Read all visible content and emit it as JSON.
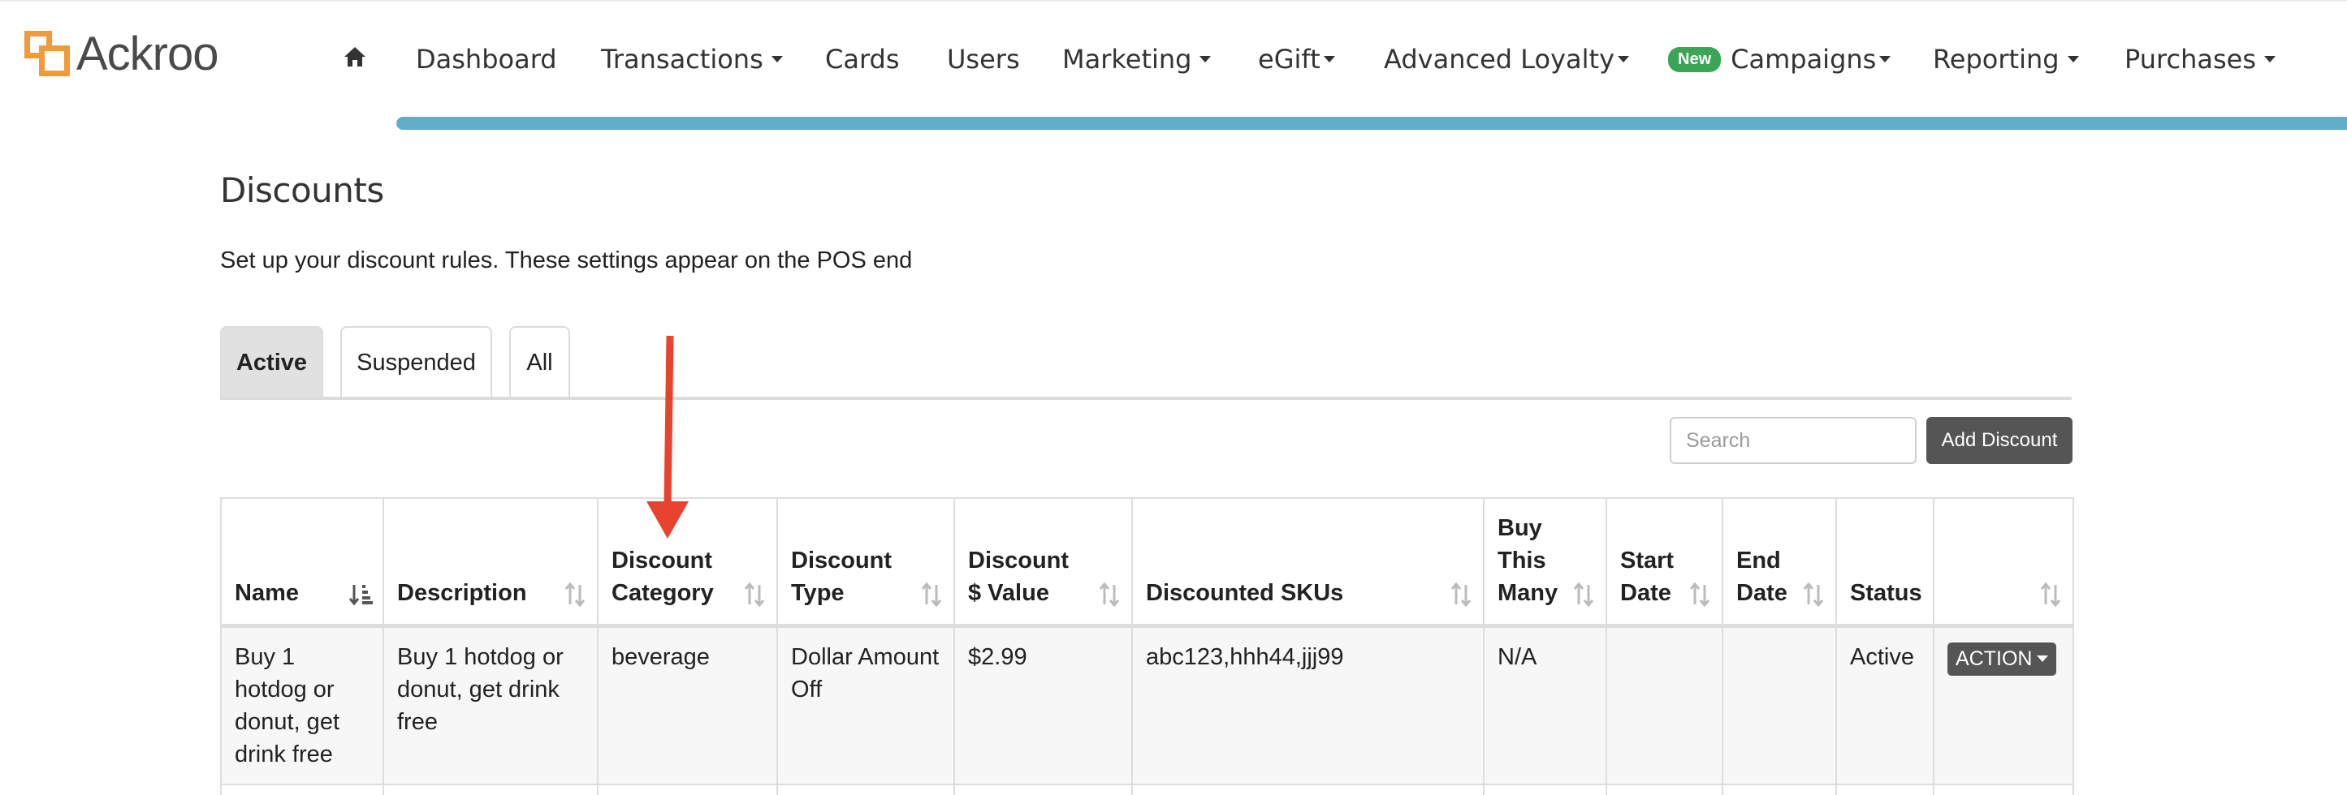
{
  "brand": {
    "name": "Ackroo"
  },
  "nav": {
    "items": [
      {
        "label": "Dashboard",
        "dropdown": false
      },
      {
        "label": "Transactions",
        "dropdown": true
      },
      {
        "label": "Cards",
        "dropdown": false
      },
      {
        "label": "Users",
        "dropdown": false
      },
      {
        "label": "Marketing",
        "dropdown": true
      },
      {
        "label": "eGift",
        "dropdown": true
      },
      {
        "label": "Advanced Loyalty",
        "dropdown": true
      },
      {
        "label": "Campaigns",
        "dropdown": true,
        "badge": "New"
      },
      {
        "label": "Reporting",
        "dropdown": true
      },
      {
        "label": "Purchases",
        "dropdown": true
      }
    ]
  },
  "page": {
    "title": "Discounts",
    "description": "Set up your discount rules. These settings appear on the POS end"
  },
  "tabs": [
    {
      "label": "Active",
      "active": true
    },
    {
      "label": "Suspended",
      "active": false
    },
    {
      "label": "All",
      "active": false
    }
  ],
  "toolbar": {
    "search_placeholder": "Search",
    "add_label": "Add Discount"
  },
  "table": {
    "columns": [
      "Name",
      "Description",
      "Discount Category",
      "Discount Type",
      "Discount $ Value",
      "Discounted SKUs",
      "Buy This Many",
      "Start Date",
      "End Date",
      "Status",
      ""
    ],
    "rows": [
      {
        "name": "Buy 1 hotdog or donut, get drink free",
        "description": "Buy 1 hotdog or donut, get drink free",
        "category": "beverage",
        "type": "Dollar Amount Off",
        "value": "$2.99",
        "skus": "abc123,hhh44,jjj99",
        "buy_many": "N/A",
        "start_date": "",
        "end_date": "",
        "status": "Active",
        "action_label": "ACTION"
      }
    ]
  },
  "colors": {
    "accent_bar": "#62aec9",
    "logo": "#f29a3a",
    "new_badge": "#3aa655",
    "button": "#555555",
    "annotation_arrow": "#e8432e"
  },
  "icons": {
    "home": "home-icon",
    "sort": "sort-icon",
    "sort_active": "sort-asc-icon"
  }
}
